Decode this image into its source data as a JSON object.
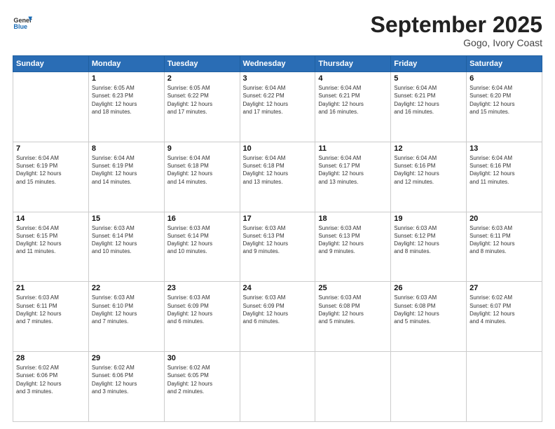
{
  "header": {
    "logo_general": "General",
    "logo_blue": "Blue",
    "month_title": "September 2025",
    "location": "Gogo, Ivory Coast"
  },
  "days_of_week": [
    "Sunday",
    "Monday",
    "Tuesday",
    "Wednesday",
    "Thursday",
    "Friday",
    "Saturday"
  ],
  "weeks": [
    [
      {
        "day": "",
        "info": ""
      },
      {
        "day": "1",
        "info": "Sunrise: 6:05 AM\nSunset: 6:23 PM\nDaylight: 12 hours\nand 18 minutes."
      },
      {
        "day": "2",
        "info": "Sunrise: 6:05 AM\nSunset: 6:22 PM\nDaylight: 12 hours\nand 17 minutes."
      },
      {
        "day": "3",
        "info": "Sunrise: 6:04 AM\nSunset: 6:22 PM\nDaylight: 12 hours\nand 17 minutes."
      },
      {
        "day": "4",
        "info": "Sunrise: 6:04 AM\nSunset: 6:21 PM\nDaylight: 12 hours\nand 16 minutes."
      },
      {
        "day": "5",
        "info": "Sunrise: 6:04 AM\nSunset: 6:21 PM\nDaylight: 12 hours\nand 16 minutes."
      },
      {
        "day": "6",
        "info": "Sunrise: 6:04 AM\nSunset: 6:20 PM\nDaylight: 12 hours\nand 15 minutes."
      }
    ],
    [
      {
        "day": "7",
        "info": "Sunrise: 6:04 AM\nSunset: 6:19 PM\nDaylight: 12 hours\nand 15 minutes."
      },
      {
        "day": "8",
        "info": "Sunrise: 6:04 AM\nSunset: 6:19 PM\nDaylight: 12 hours\nand 14 minutes."
      },
      {
        "day": "9",
        "info": "Sunrise: 6:04 AM\nSunset: 6:18 PM\nDaylight: 12 hours\nand 14 minutes."
      },
      {
        "day": "10",
        "info": "Sunrise: 6:04 AM\nSunset: 6:18 PM\nDaylight: 12 hours\nand 13 minutes."
      },
      {
        "day": "11",
        "info": "Sunrise: 6:04 AM\nSunset: 6:17 PM\nDaylight: 12 hours\nand 13 minutes."
      },
      {
        "day": "12",
        "info": "Sunrise: 6:04 AM\nSunset: 6:16 PM\nDaylight: 12 hours\nand 12 minutes."
      },
      {
        "day": "13",
        "info": "Sunrise: 6:04 AM\nSunset: 6:16 PM\nDaylight: 12 hours\nand 11 minutes."
      }
    ],
    [
      {
        "day": "14",
        "info": "Sunrise: 6:04 AM\nSunset: 6:15 PM\nDaylight: 12 hours\nand 11 minutes."
      },
      {
        "day": "15",
        "info": "Sunrise: 6:03 AM\nSunset: 6:14 PM\nDaylight: 12 hours\nand 10 minutes."
      },
      {
        "day": "16",
        "info": "Sunrise: 6:03 AM\nSunset: 6:14 PM\nDaylight: 12 hours\nand 10 minutes."
      },
      {
        "day": "17",
        "info": "Sunrise: 6:03 AM\nSunset: 6:13 PM\nDaylight: 12 hours\nand 9 minutes."
      },
      {
        "day": "18",
        "info": "Sunrise: 6:03 AM\nSunset: 6:13 PM\nDaylight: 12 hours\nand 9 minutes."
      },
      {
        "day": "19",
        "info": "Sunrise: 6:03 AM\nSunset: 6:12 PM\nDaylight: 12 hours\nand 8 minutes."
      },
      {
        "day": "20",
        "info": "Sunrise: 6:03 AM\nSunset: 6:11 PM\nDaylight: 12 hours\nand 8 minutes."
      }
    ],
    [
      {
        "day": "21",
        "info": "Sunrise: 6:03 AM\nSunset: 6:11 PM\nDaylight: 12 hours\nand 7 minutes."
      },
      {
        "day": "22",
        "info": "Sunrise: 6:03 AM\nSunset: 6:10 PM\nDaylight: 12 hours\nand 7 minutes."
      },
      {
        "day": "23",
        "info": "Sunrise: 6:03 AM\nSunset: 6:09 PM\nDaylight: 12 hours\nand 6 minutes."
      },
      {
        "day": "24",
        "info": "Sunrise: 6:03 AM\nSunset: 6:09 PM\nDaylight: 12 hours\nand 6 minutes."
      },
      {
        "day": "25",
        "info": "Sunrise: 6:03 AM\nSunset: 6:08 PM\nDaylight: 12 hours\nand 5 minutes."
      },
      {
        "day": "26",
        "info": "Sunrise: 6:03 AM\nSunset: 6:08 PM\nDaylight: 12 hours\nand 5 minutes."
      },
      {
        "day": "27",
        "info": "Sunrise: 6:02 AM\nSunset: 6:07 PM\nDaylight: 12 hours\nand 4 minutes."
      }
    ],
    [
      {
        "day": "28",
        "info": "Sunrise: 6:02 AM\nSunset: 6:06 PM\nDaylight: 12 hours\nand 3 minutes."
      },
      {
        "day": "29",
        "info": "Sunrise: 6:02 AM\nSunset: 6:06 PM\nDaylight: 12 hours\nand 3 minutes."
      },
      {
        "day": "30",
        "info": "Sunrise: 6:02 AM\nSunset: 6:05 PM\nDaylight: 12 hours\nand 2 minutes."
      },
      {
        "day": "",
        "info": ""
      },
      {
        "day": "",
        "info": ""
      },
      {
        "day": "",
        "info": ""
      },
      {
        "day": "",
        "info": ""
      }
    ]
  ]
}
